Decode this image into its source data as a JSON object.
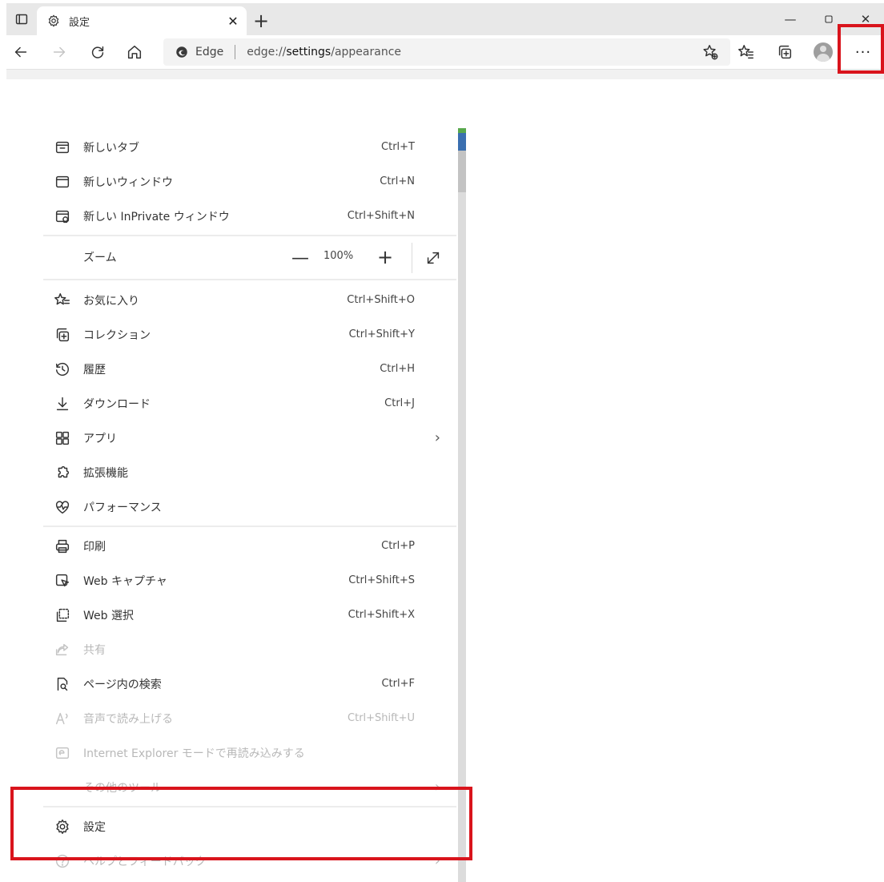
{
  "colors": {
    "highlight": "#d9141c",
    "tab_bar": "#e8e8e8",
    "address_bar": "#f3f3f3"
  },
  "tab": {
    "title": "設定",
    "icon": "gear-icon"
  },
  "address": {
    "brand": "Edge",
    "scheme": "edge://",
    "host": "settings",
    "path": "/appearance"
  },
  "menu": {
    "items_top": [
      {
        "label": "新しいタブ",
        "shortcut": "Ctrl+T",
        "icon": "new-tab-icon"
      },
      {
        "label": "新しいウィンドウ",
        "shortcut": "Ctrl+N",
        "icon": "new-window-icon"
      },
      {
        "label": "新しい InPrivate ウィンドウ",
        "shortcut": "Ctrl+Shift+N",
        "icon": "inprivate-icon"
      }
    ],
    "zoom": {
      "label": "ズーム",
      "minus": "—",
      "value": "100%",
      "plus": "+"
    },
    "items_mid": [
      {
        "label": "お気に入り",
        "shortcut": "Ctrl+Shift+O",
        "icon": "favorites-icon"
      },
      {
        "label": "コレクション",
        "shortcut": "Ctrl+Shift+Y",
        "icon": "collections-icon"
      },
      {
        "label": "履歴",
        "shortcut": "Ctrl+H",
        "icon": "history-icon"
      },
      {
        "label": "ダウンロード",
        "shortcut": "Ctrl+J",
        "icon": "download-icon"
      },
      {
        "label": "アプリ",
        "shortcut": "",
        "icon": "apps-icon"
      },
      {
        "label": "拡張機能",
        "shortcut": "",
        "icon": "extensions-icon"
      },
      {
        "label": "パフォーマンス",
        "shortcut": "",
        "icon": "performance-icon"
      }
    ],
    "items_low": [
      {
        "label": "印刷",
        "shortcut": "Ctrl+P",
        "icon": "print-icon"
      },
      {
        "label": "Web キャプチャ",
        "shortcut": "Ctrl+Shift+S",
        "icon": "web-capture-icon"
      },
      {
        "label": "Web 選択",
        "shortcut": "Ctrl+Shift+X",
        "icon": "web-select-icon"
      },
      {
        "label": "共有",
        "shortcut": "",
        "icon": "share-icon"
      },
      {
        "label": "ページ内の検索",
        "shortcut": "Ctrl+F",
        "icon": "find-icon"
      },
      {
        "label": "音声で読み上げる",
        "shortcut": "Ctrl+Shift+U",
        "icon": "read-aloud-icon"
      },
      {
        "label": "Internet Explorer モードで再読み込みする",
        "shortcut": "",
        "icon": "ie-mode-icon"
      },
      {
        "label": "その他のツール",
        "shortcut": "",
        "icon": ""
      }
    ],
    "items_bottom": [
      {
        "label": "設定",
        "shortcut": "",
        "icon": "gear-icon"
      },
      {
        "label": "ヘルプとフィードバック",
        "shortcut": "",
        "icon": "help-icon"
      }
    ]
  }
}
